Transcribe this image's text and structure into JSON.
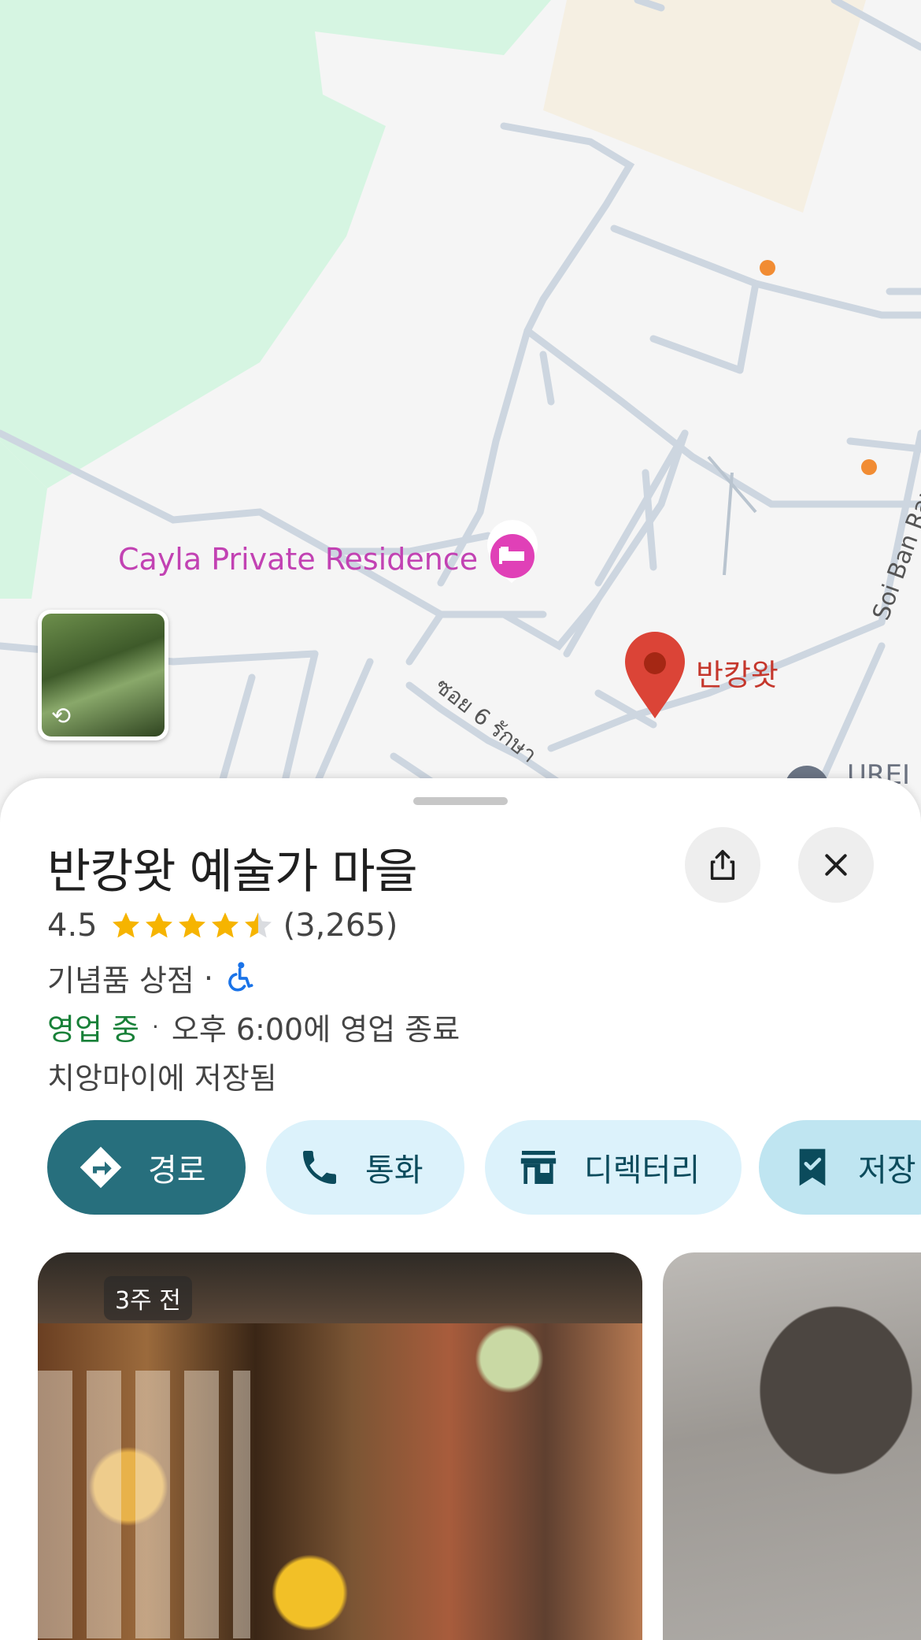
{
  "map": {
    "poi_hotel_label": "Cayla Private Residence",
    "pin_label": "반캉왓",
    "street_thai": "ซอย 6 รักษา",
    "street_soi": "Soi Ban Ram P",
    "poi_partial": "UREI",
    "colors": {
      "park": "#d6f5e2",
      "sand": "#f5efe2",
      "road": "#cdd6e0",
      "pin": "#db4437",
      "hotel": "#e040b7"
    }
  },
  "place": {
    "title": "반캉왓 예술가 마을",
    "rating": "4.5",
    "rating_value": 4.5,
    "reviews": "(3,265)",
    "category": "기념품 상점",
    "separator": "·",
    "open_status": "영업 중",
    "closing": "오후 6:00에 영업 종료",
    "saved": "치앙마이에 저장됨"
  },
  "actions": [
    {
      "label": "경로",
      "icon": "directions-icon"
    },
    {
      "label": "통화",
      "icon": "phone-icon"
    },
    {
      "label": "디렉터리",
      "icon": "store-icon"
    },
    {
      "label": "저장",
      "icon": "bookmark-check-icon"
    }
  ],
  "photos": {
    "main_badge": "3주 전"
  }
}
